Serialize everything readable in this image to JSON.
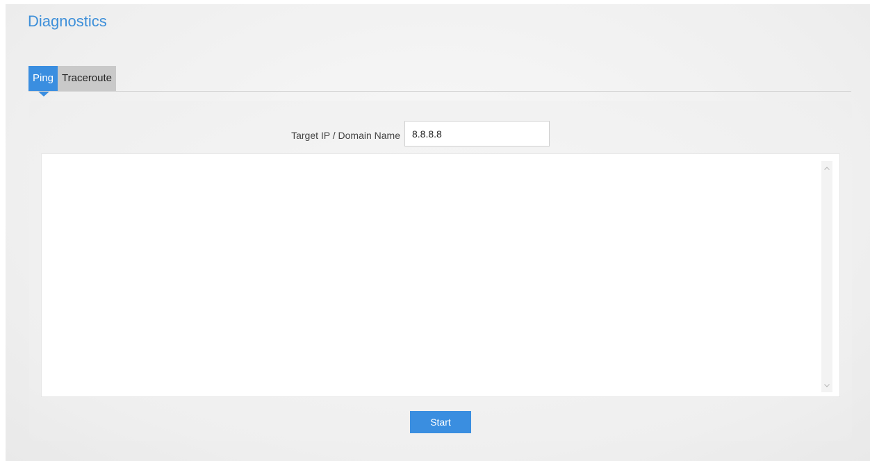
{
  "page": {
    "title": "Diagnostics"
  },
  "tabs": [
    {
      "label": "Ping",
      "active": true
    },
    {
      "label": "Traceroute",
      "active": false
    }
  ],
  "form": {
    "target_label": "Target IP / Domain Name",
    "target_value": "8.8.8.8"
  },
  "output": {
    "text": ""
  },
  "actions": {
    "start_label": "Start"
  },
  "colors": {
    "accent": "#3a8ee0",
    "title": "#3d8fd9",
    "inactive_tab": "#c9c9c9"
  },
  "icons": {
    "scroll_up": "chevron-up-icon",
    "scroll_down": "chevron-down-icon"
  }
}
